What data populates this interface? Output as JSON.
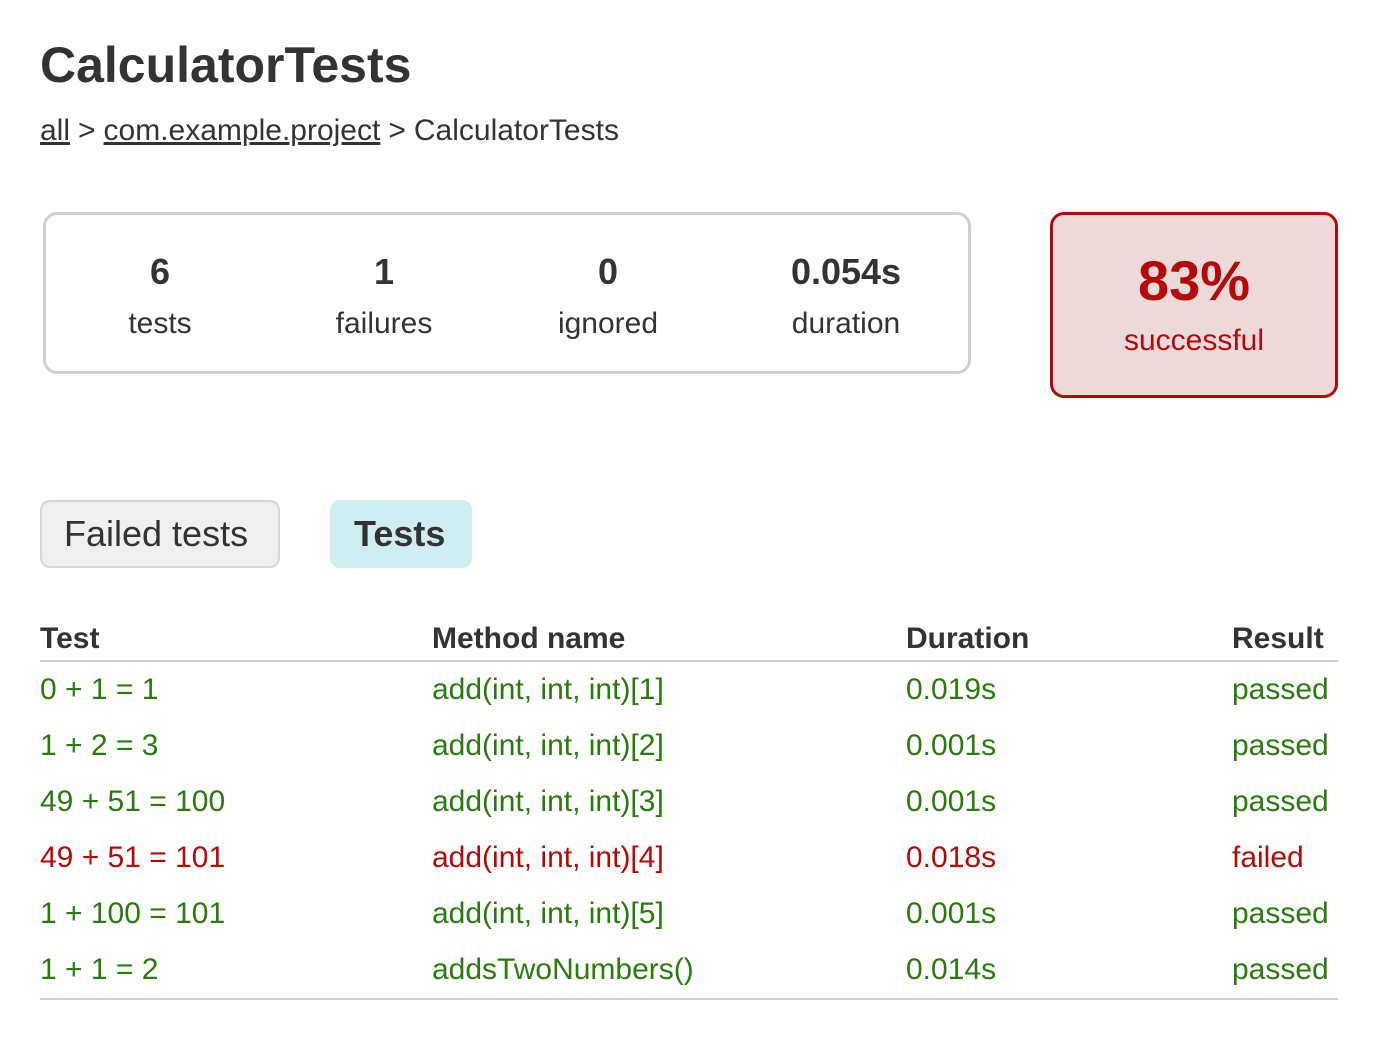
{
  "page": {
    "title": "CalculatorTests"
  },
  "breadcrumb": {
    "items": [
      {
        "label": "all",
        "link": true
      },
      {
        "label": "com.example.project",
        "link": true
      },
      {
        "label": "CalculatorTests",
        "link": false
      }
    ],
    "separator": ">"
  },
  "summary": {
    "tests": {
      "value": "6",
      "label": "tests"
    },
    "failures": {
      "value": "1",
      "label": "failures"
    },
    "ignored": {
      "value": "0",
      "label": "ignored"
    },
    "duration": {
      "value": "0.054s",
      "label": "duration"
    }
  },
  "success": {
    "percent": "83%",
    "label": "successful"
  },
  "tabs": {
    "failed_label": "Failed tests",
    "tests_label": "Tests",
    "active": "Tests"
  },
  "table": {
    "headers": [
      "Test",
      "Method name",
      "Duration",
      "Result"
    ],
    "rows": [
      {
        "test": "0 + 1 = 1",
        "method": "add(int, int, int)[1]",
        "duration": "0.019s",
        "result": "passed"
      },
      {
        "test": "1 + 2 = 3",
        "method": "add(int, int, int)[2]",
        "duration": "0.001s",
        "result": "passed"
      },
      {
        "test": "49 + 51 = 100",
        "method": "add(int, int, int)[3]",
        "duration": "0.001s",
        "result": "passed"
      },
      {
        "test": "49 + 51 = 101",
        "method": "add(int, int, int)[4]",
        "duration": "0.018s",
        "result": "failed"
      },
      {
        "test": "1 + 100 = 101",
        "method": "add(int, int, int)[5]",
        "duration": "0.001s",
        "result": "passed"
      },
      {
        "test": "1 + 1 = 2",
        "method": "addsTwoNumbers()",
        "duration": "0.014s",
        "result": "passed"
      }
    ]
  },
  "colors": {
    "passed": "#2b7a10",
    "failed": "#b60808",
    "success_bg": "#ecdada",
    "active_tab_bg": "#d0edf2"
  }
}
